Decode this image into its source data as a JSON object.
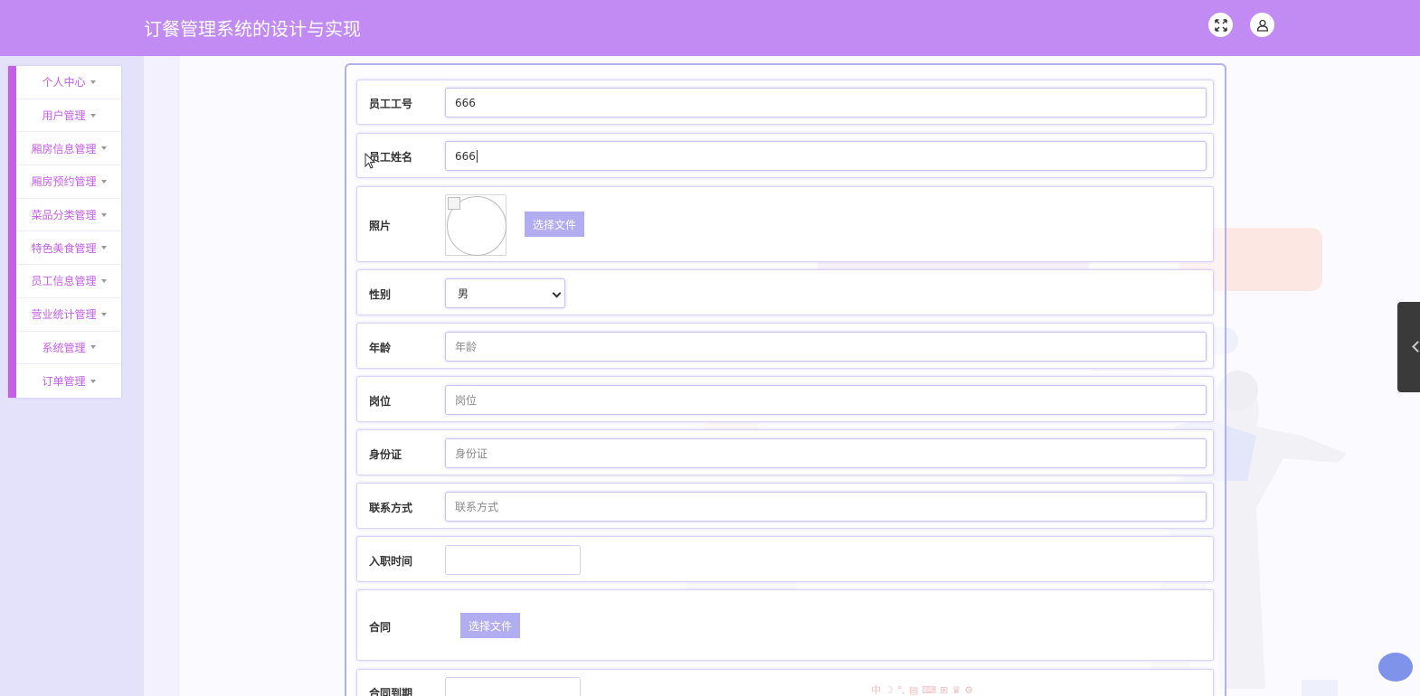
{
  "header": {
    "title": "订餐管理系统的设计与实现",
    "fullscreen_icon": "expand-arrows-icon",
    "user_icon": "user-icon"
  },
  "sidebar": {
    "items": [
      {
        "label": "个人中心"
      },
      {
        "label": "用户管理"
      },
      {
        "label": "厢房信息管理"
      },
      {
        "label": "厢房预约管理"
      },
      {
        "label": "菜品分类管理"
      },
      {
        "label": "特色美食管理"
      },
      {
        "label": "员工信息管理"
      },
      {
        "label": "营业统计管理"
      },
      {
        "label": "系统管理"
      },
      {
        "label": "订单管理"
      }
    ]
  },
  "form": {
    "employee_id": {
      "label": "员工工号",
      "value": "666"
    },
    "employee_name": {
      "label": "员工姓名",
      "value": "666"
    },
    "photo": {
      "label": "照片",
      "button": "选择文件"
    },
    "gender": {
      "label": "性别",
      "value": "男"
    },
    "age": {
      "label": "年龄",
      "placeholder": "年龄"
    },
    "position": {
      "label": "岗位",
      "placeholder": "岗位"
    },
    "id_card": {
      "label": "身份证",
      "placeholder": "身份证"
    },
    "contact": {
      "label": "联系方式",
      "placeholder": "联系方式"
    },
    "hire_date": {
      "label": "入职时间",
      "value": ""
    },
    "contract": {
      "label": "合同",
      "button": "选择文件"
    },
    "contract_expiry": {
      "label": "合同到期",
      "value": ""
    }
  },
  "ime_toolbar": [
    "中",
    "☽",
    "°,",
    "▤",
    "⌨",
    "⊞",
    "♛",
    "⚙"
  ],
  "colors": {
    "header_bg": "#c28af3",
    "accent": "#c45fe6",
    "button_bg": "#b2adf1",
    "page_bg": "#e4e1fb"
  }
}
